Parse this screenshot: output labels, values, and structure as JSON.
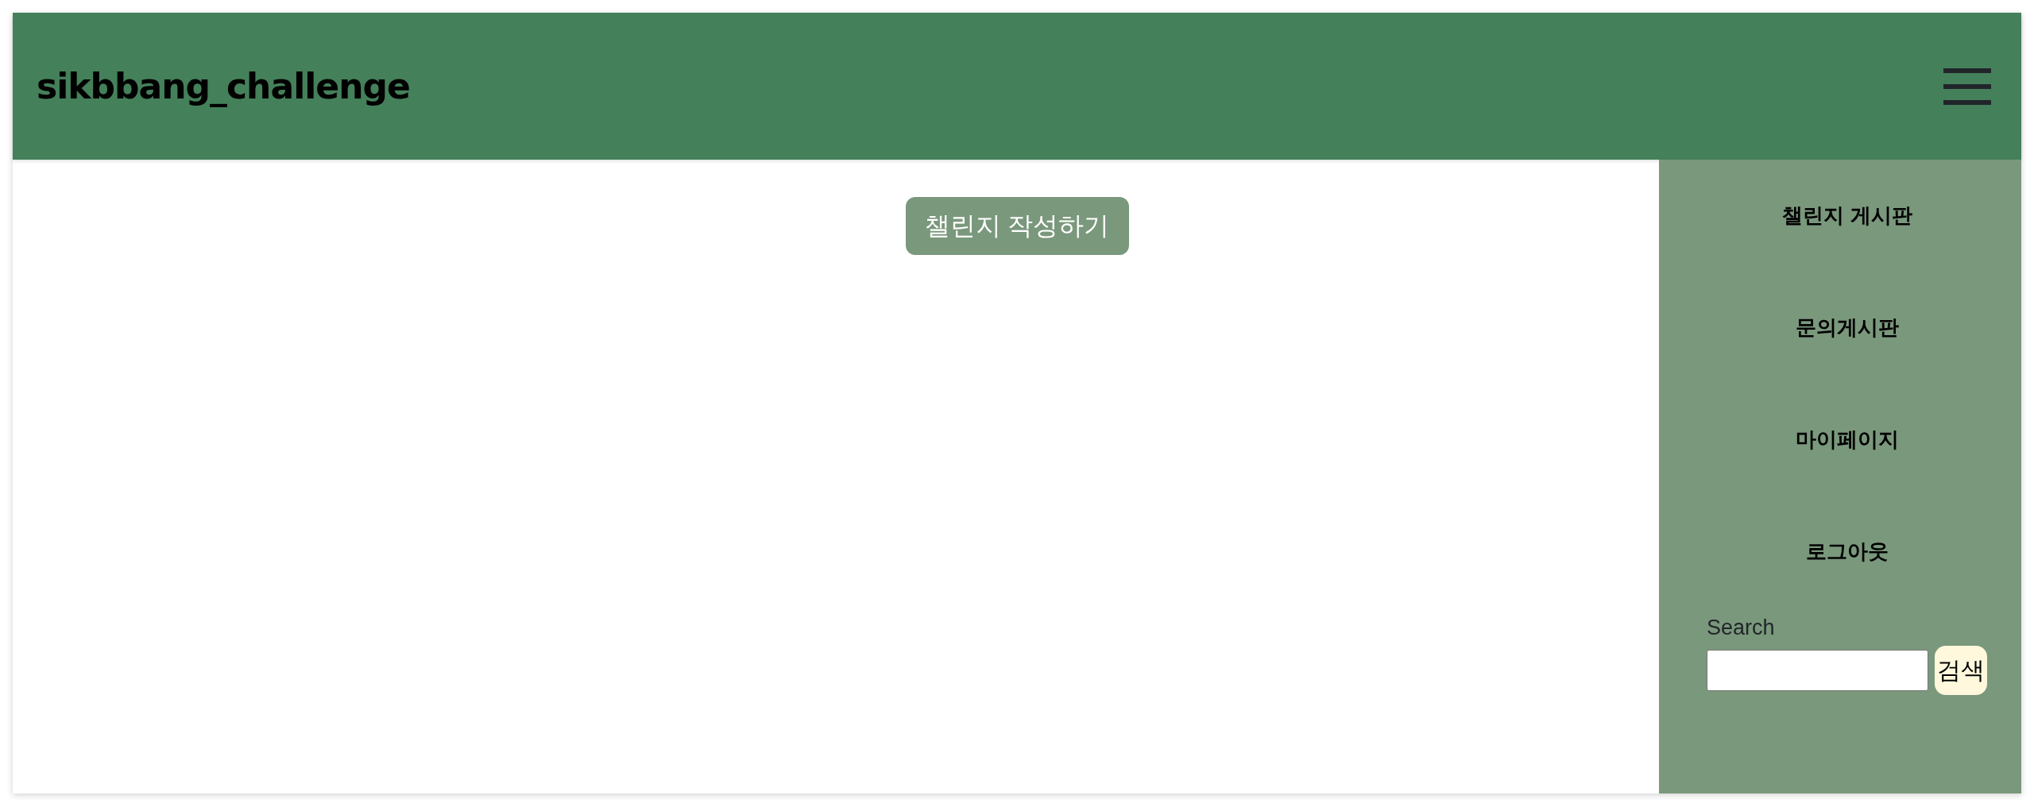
{
  "header": {
    "title": "sikbbang_challenge"
  },
  "main": {
    "create_button": "챌린지 작성하기"
  },
  "sidebar": {
    "items": [
      "챌린지 게시판",
      "문의게시판",
      "마이페이지",
      "로그아웃"
    ],
    "search": {
      "label": "Search",
      "button": "검색"
    }
  }
}
